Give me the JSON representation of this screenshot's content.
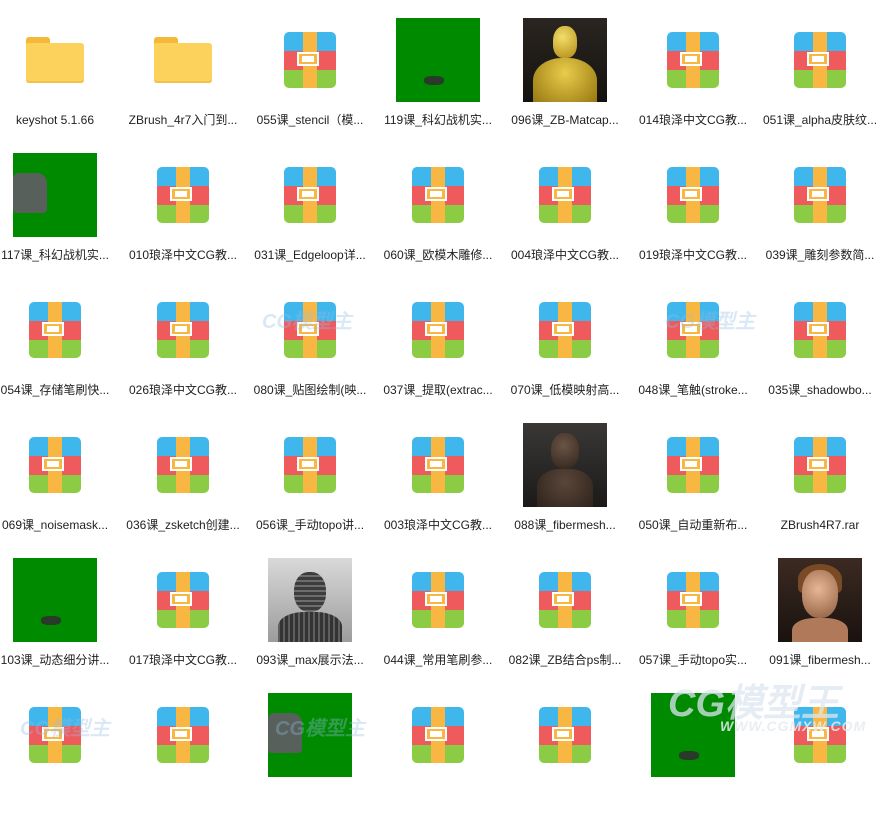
{
  "window": {
    "view": "large-icons"
  },
  "colors": {
    "folder": "#fcd15c",
    "rar_blue": "#3fb6ec",
    "rar_red": "#ef5a5d",
    "rar_green": "#8ccc45",
    "rar_strap": "#f7b742",
    "thumb_green": "#008a00"
  },
  "files": [
    {
      "name": "keyshot 5.1.66",
      "icon": "folder-icon"
    },
    {
      "name": "ZBrush_4r7入门到...",
      "icon": "folder-icon"
    },
    {
      "name": "055课_stencil（模...",
      "icon": "rar-archive-icon"
    },
    {
      "name": "119课_科幻战机实...",
      "icon": "green-thumbnail"
    },
    {
      "name": "096课_ZB-Matcap...",
      "icon": "gold-bust-thumbnail"
    },
    {
      "name": "014琅泽中文CG教...",
      "icon": "rar-archive-icon"
    },
    {
      "name": "051课_alpha皮肤纹...",
      "icon": "rar-archive-icon"
    },
    {
      "name": "117课_科幻战机实...",
      "icon": "green-model-thumbnail"
    },
    {
      "name": "010琅泽中文CG教...",
      "icon": "rar-archive-icon"
    },
    {
      "name": "031课_Edgeloop详...",
      "icon": "rar-archive-icon"
    },
    {
      "name": "060课_欧模木雕修...",
      "icon": "rar-archive-icon"
    },
    {
      "name": "004琅泽中文CG教...",
      "icon": "rar-archive-icon"
    },
    {
      "name": "019琅泽中文CG教...",
      "icon": "rar-archive-icon"
    },
    {
      "name": "039课_雕刻参数简...",
      "icon": "rar-archive-icon"
    },
    {
      "name": "054课_存储笔刷快...",
      "icon": "rar-archive-icon"
    },
    {
      "name": "026琅泽中文CG教...",
      "icon": "rar-archive-icon"
    },
    {
      "name": "080课_贴图绘制(映...",
      "icon": "rar-archive-icon"
    },
    {
      "name": "037课_提取(extrac...",
      "icon": "rar-archive-icon"
    },
    {
      "name": "070课_低模映射高...",
      "icon": "rar-archive-icon"
    },
    {
      "name": "048课_笔触(stroke...",
      "icon": "rar-archive-icon"
    },
    {
      "name": "035课_shadowbo...",
      "icon": "rar-archive-icon"
    },
    {
      "name": "069课_noisemask...",
      "icon": "rar-archive-icon"
    },
    {
      "name": "036课_zsketch创建...",
      "icon": "rar-archive-icon"
    },
    {
      "name": "056课_手动topo讲...",
      "icon": "rar-archive-icon"
    },
    {
      "name": "003琅泽中文CG教...",
      "icon": "rar-archive-icon"
    },
    {
      "name": "088课_fibermesh...",
      "icon": "dark-bust-thumbnail"
    },
    {
      "name": "050课_自动重新布...",
      "icon": "rar-archive-icon"
    },
    {
      "name": "ZBrush4R7.rar",
      "icon": "rar-archive-icon"
    },
    {
      "name": "103课_动态细分讲...",
      "icon": "green-thumbnail"
    },
    {
      "name": "017琅泽中文CG教...",
      "icon": "rar-archive-icon"
    },
    {
      "name": "093课_max展示法...",
      "icon": "mesh-bust-thumbnail"
    },
    {
      "name": "044课_常用笔刷参...",
      "icon": "rar-archive-icon"
    },
    {
      "name": "082课_ZB结合ps制...",
      "icon": "rar-archive-icon"
    },
    {
      "name": "057课_手动topo实...",
      "icon": "rar-archive-icon"
    },
    {
      "name": "091课_fibermesh...",
      "icon": "female-head-thumbnail"
    },
    {
      "name": "",
      "icon": "rar-archive-icon"
    },
    {
      "name": "",
      "icon": "rar-archive-icon"
    },
    {
      "name": "",
      "icon": "green-model-thumbnail"
    },
    {
      "name": "",
      "icon": "rar-archive-icon"
    },
    {
      "name": "",
      "icon": "rar-archive-icon"
    },
    {
      "name": "",
      "icon": "green-thumbnail"
    },
    {
      "name": "",
      "icon": "rar-archive-icon"
    }
  ],
  "watermarks": {
    "small": "CG模型主",
    "big": "CG模型王",
    "url": "WWW.CGMXW.COM"
  }
}
